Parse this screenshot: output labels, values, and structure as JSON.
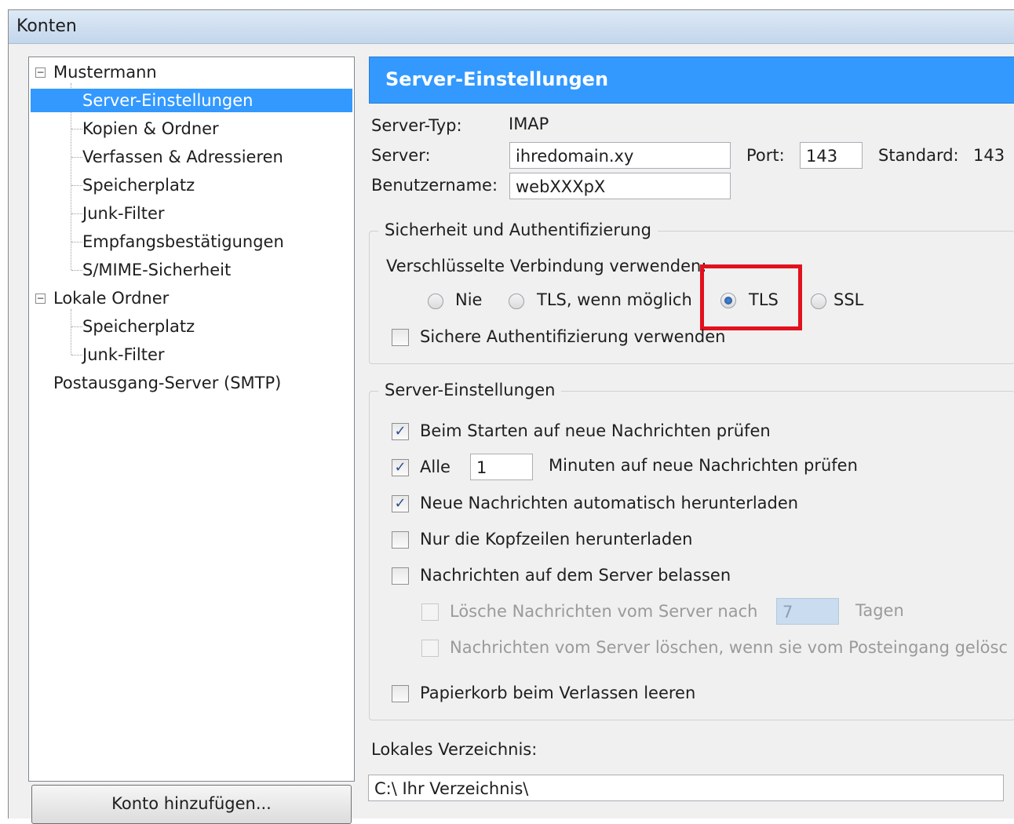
{
  "window": {
    "title": "Konten"
  },
  "tree": {
    "account1": "Mustermann",
    "account1_items": [
      "Server-Einstellungen",
      "Kopien & Ordner",
      "Verfassen & Adressieren",
      "Speicherplatz",
      "Junk-Filter",
      "Empfangsbestätigungen",
      "S/MIME-Sicherheit"
    ],
    "account2": "Lokale Ordner",
    "account2_items": [
      "Speicherplatz",
      "Junk-Filter"
    ],
    "smtp": "Postausgang-Server (SMTP)"
  },
  "add_account_button": "Konto hinzufügen...",
  "panel": {
    "title": "Server-Einstellungen",
    "server_type_label": "Server-Typ:",
    "server_type_value": "IMAP",
    "server_label": "Server:",
    "server_value": "ihredomain.xy",
    "port_label": "Port:",
    "port_value": "143",
    "standard_label": "Standard:",
    "standard_value": "143",
    "username_label": "Benutzername:",
    "username_value": "webXXXpX"
  },
  "security": {
    "legend": "Sicherheit und Authentifizierung",
    "encrypted_label": "Verschlüsselte Verbindung verwenden:",
    "options": [
      "Nie",
      "TLS, wenn möglich",
      "TLS",
      "SSL"
    ],
    "selected": "TLS",
    "secure_auth_label": "Sichere Authentifizierung verwenden"
  },
  "server_settings": {
    "legend": "Server-Einstellungen",
    "check_on_start": "Beim Starten auf neue Nachrichten prüfen",
    "every_label": "Alle",
    "every_value": "1",
    "minutes_label": "Minuten auf neue Nachrichten prüfen",
    "auto_download": "Neue Nachrichten automatisch herunterladen",
    "headers_only": "Nur die Kopfzeilen herunterladen",
    "leave_on_server": "Nachrichten auf dem Server belassen",
    "delete_after": "Lösche Nachrichten vom Server nach",
    "delete_days": "7",
    "days_label": "Tagen",
    "delete_when_removed": "Nachrichten vom Server löschen, wenn sie vom Posteingang gelösc",
    "empty_trash": "Papierkorb beim Verlassen leeren"
  },
  "local_dir": {
    "label": "Lokales Verzeichnis:",
    "value": "C:\\ Ihr Verzeichnis\\"
  }
}
